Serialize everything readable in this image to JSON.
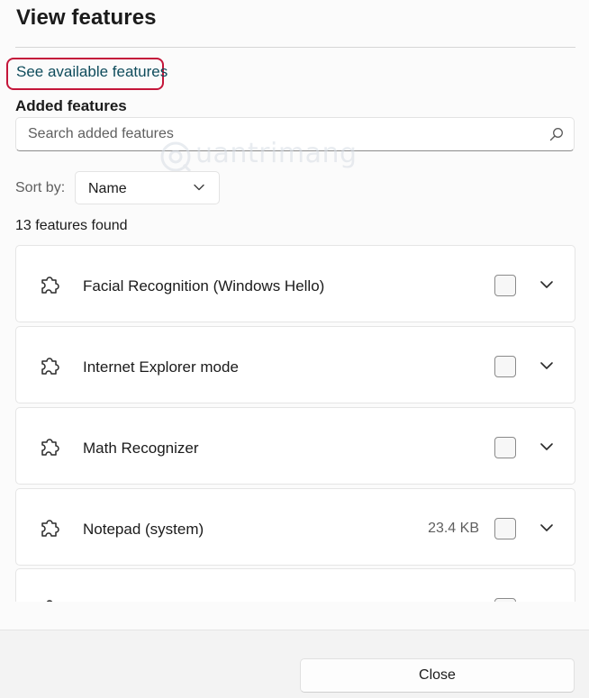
{
  "dialog": {
    "title": "View features",
    "link_label": "See available features",
    "section_label": "Added features",
    "search": {
      "placeholder": "Search added features",
      "value": ""
    },
    "sort": {
      "label": "Sort by:",
      "selected": "Name"
    },
    "count_text": "13 features found",
    "features": [
      {
        "label": "Facial Recognition (Windows Hello)",
        "size": "",
        "checked": false
      },
      {
        "label": "Internet Explorer mode",
        "size": "",
        "checked": false
      },
      {
        "label": "Math Recognizer",
        "size": "",
        "checked": false
      },
      {
        "label": "Notepad (system)",
        "size": "23.4 KB",
        "checked": false
      },
      {
        "label": "",
        "size": "",
        "checked": false
      }
    ],
    "close_label": "Close"
  },
  "watermark": {
    "text": "uantrimang"
  },
  "icons": {
    "search": "search-icon",
    "sort": "chevron-down-icon",
    "feature": "puzzle-piece-icon",
    "expand": "chevron-down-icon"
  },
  "colors": {
    "accent_link": "#0f4c5c",
    "highlight_border": "#c4163a"
  }
}
